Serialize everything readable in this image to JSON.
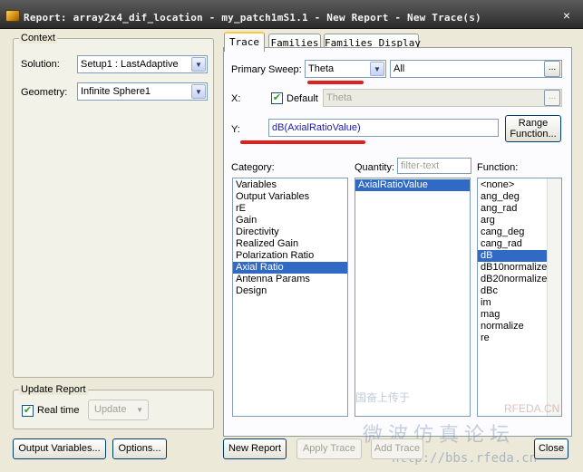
{
  "window": {
    "title": "Report: array2x4_dif_location - my_patch1mS1.1 - New Report - New Trace(s)",
    "close_label": "×"
  },
  "context": {
    "legend": "Context",
    "solution_label": "Solution:",
    "solution_value": "Setup1 : LastAdaptive",
    "geometry_label": "Geometry:",
    "geometry_value": "Infinite Sphere1"
  },
  "update": {
    "legend": "Update Report",
    "realtime_label": "Real time",
    "realtime_checked": true,
    "update_label": "Update"
  },
  "tabs": [
    {
      "label": "Trace",
      "active": true
    },
    {
      "label": "Families",
      "active": false
    },
    {
      "label": "Families Display",
      "active": false
    }
  ],
  "trace": {
    "primary_sweep_label": "Primary Sweep:",
    "primary_sweep_value": "Theta",
    "primary_sweep_range": "All",
    "ellipsis": "...",
    "x_label": "X:",
    "x_default_label": "Default",
    "x_default_checked": true,
    "x_value": "Theta",
    "y_label": "Y:",
    "y_value": "dB(AxialRatioValue)",
    "range_function_label_1": "Range",
    "range_function_label_2": "Function..."
  },
  "category": {
    "label": "Category:",
    "items": [
      "Variables",
      "Output Variables",
      "rE",
      "Gain",
      "Directivity",
      "Realized Gain",
      "Polarization Ratio",
      "Axial Ratio",
      "Antenna Params",
      "Design"
    ],
    "selected": "Axial Ratio"
  },
  "quantity": {
    "label": "Quantity:",
    "filter_placeholder": "filter-text",
    "items": [
      "AxialRatioValue"
    ],
    "selected": "AxialRatioValue"
  },
  "function": {
    "label": "Function:",
    "items": [
      "<none>",
      "ang_deg",
      "ang_rad",
      "arg",
      "cang_deg",
      "cang_rad",
      "dB",
      "dB10normalize",
      "dB20normalize",
      "dBc",
      "im",
      "mag",
      "normalize",
      "re"
    ],
    "selected": "dB"
  },
  "buttons": {
    "output_variables": "Output Variables...",
    "options": "Options...",
    "new_report": "New Report",
    "apply_trace": "Apply Trace",
    "add_trace": "Add Trace",
    "close": "Close"
  },
  "watermark": {
    "line1": "微波仿真论坛",
    "line2": "http://bbs.rfeda.cn",
    "line3": "RFEDA.CN",
    "line4": "国奋上传于"
  },
  "colors": {
    "selection": "#316ac5",
    "annotation_red": "#e0201a"
  }
}
